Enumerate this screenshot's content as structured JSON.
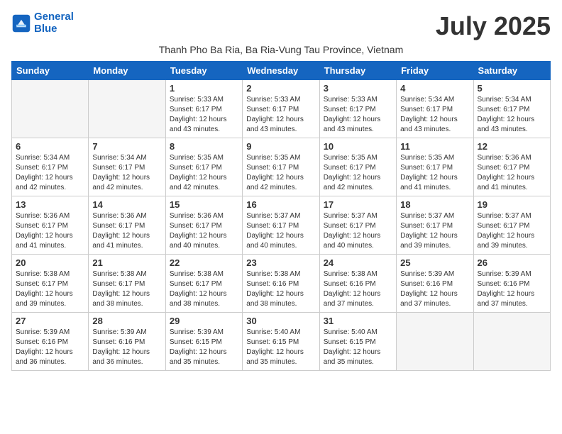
{
  "header": {
    "logo_line1": "General",
    "logo_line2": "Blue",
    "month_title": "July 2025",
    "subtitle": "Thanh Pho Ba Ria, Ba Ria-Vung Tau Province, Vietnam"
  },
  "weekdays": [
    "Sunday",
    "Monday",
    "Tuesday",
    "Wednesday",
    "Thursday",
    "Friday",
    "Saturday"
  ],
  "weeks": [
    [
      {
        "day": "",
        "info": ""
      },
      {
        "day": "",
        "info": ""
      },
      {
        "day": "1",
        "info": "Sunrise: 5:33 AM\nSunset: 6:17 PM\nDaylight: 12 hours and 43 minutes."
      },
      {
        "day": "2",
        "info": "Sunrise: 5:33 AM\nSunset: 6:17 PM\nDaylight: 12 hours and 43 minutes."
      },
      {
        "day": "3",
        "info": "Sunrise: 5:33 AM\nSunset: 6:17 PM\nDaylight: 12 hours and 43 minutes."
      },
      {
        "day": "4",
        "info": "Sunrise: 5:34 AM\nSunset: 6:17 PM\nDaylight: 12 hours and 43 minutes."
      },
      {
        "day": "5",
        "info": "Sunrise: 5:34 AM\nSunset: 6:17 PM\nDaylight: 12 hours and 43 minutes."
      }
    ],
    [
      {
        "day": "6",
        "info": "Sunrise: 5:34 AM\nSunset: 6:17 PM\nDaylight: 12 hours and 42 minutes."
      },
      {
        "day": "7",
        "info": "Sunrise: 5:34 AM\nSunset: 6:17 PM\nDaylight: 12 hours and 42 minutes."
      },
      {
        "day": "8",
        "info": "Sunrise: 5:35 AM\nSunset: 6:17 PM\nDaylight: 12 hours and 42 minutes."
      },
      {
        "day": "9",
        "info": "Sunrise: 5:35 AM\nSunset: 6:17 PM\nDaylight: 12 hours and 42 minutes."
      },
      {
        "day": "10",
        "info": "Sunrise: 5:35 AM\nSunset: 6:17 PM\nDaylight: 12 hours and 42 minutes."
      },
      {
        "day": "11",
        "info": "Sunrise: 5:35 AM\nSunset: 6:17 PM\nDaylight: 12 hours and 41 minutes."
      },
      {
        "day": "12",
        "info": "Sunrise: 5:36 AM\nSunset: 6:17 PM\nDaylight: 12 hours and 41 minutes."
      }
    ],
    [
      {
        "day": "13",
        "info": "Sunrise: 5:36 AM\nSunset: 6:17 PM\nDaylight: 12 hours and 41 minutes."
      },
      {
        "day": "14",
        "info": "Sunrise: 5:36 AM\nSunset: 6:17 PM\nDaylight: 12 hours and 41 minutes."
      },
      {
        "day": "15",
        "info": "Sunrise: 5:36 AM\nSunset: 6:17 PM\nDaylight: 12 hours and 40 minutes."
      },
      {
        "day": "16",
        "info": "Sunrise: 5:37 AM\nSunset: 6:17 PM\nDaylight: 12 hours and 40 minutes."
      },
      {
        "day": "17",
        "info": "Sunrise: 5:37 AM\nSunset: 6:17 PM\nDaylight: 12 hours and 40 minutes."
      },
      {
        "day": "18",
        "info": "Sunrise: 5:37 AM\nSunset: 6:17 PM\nDaylight: 12 hours and 39 minutes."
      },
      {
        "day": "19",
        "info": "Sunrise: 5:37 AM\nSunset: 6:17 PM\nDaylight: 12 hours and 39 minutes."
      }
    ],
    [
      {
        "day": "20",
        "info": "Sunrise: 5:38 AM\nSunset: 6:17 PM\nDaylight: 12 hours and 39 minutes."
      },
      {
        "day": "21",
        "info": "Sunrise: 5:38 AM\nSunset: 6:17 PM\nDaylight: 12 hours and 38 minutes."
      },
      {
        "day": "22",
        "info": "Sunrise: 5:38 AM\nSunset: 6:17 PM\nDaylight: 12 hours and 38 minutes."
      },
      {
        "day": "23",
        "info": "Sunrise: 5:38 AM\nSunset: 6:16 PM\nDaylight: 12 hours and 38 minutes."
      },
      {
        "day": "24",
        "info": "Sunrise: 5:38 AM\nSunset: 6:16 PM\nDaylight: 12 hours and 37 minutes."
      },
      {
        "day": "25",
        "info": "Sunrise: 5:39 AM\nSunset: 6:16 PM\nDaylight: 12 hours and 37 minutes."
      },
      {
        "day": "26",
        "info": "Sunrise: 5:39 AM\nSunset: 6:16 PM\nDaylight: 12 hours and 37 minutes."
      }
    ],
    [
      {
        "day": "27",
        "info": "Sunrise: 5:39 AM\nSunset: 6:16 PM\nDaylight: 12 hours and 36 minutes."
      },
      {
        "day": "28",
        "info": "Sunrise: 5:39 AM\nSunset: 6:16 PM\nDaylight: 12 hours and 36 minutes."
      },
      {
        "day": "29",
        "info": "Sunrise: 5:39 AM\nSunset: 6:15 PM\nDaylight: 12 hours and 35 minutes."
      },
      {
        "day": "30",
        "info": "Sunrise: 5:40 AM\nSunset: 6:15 PM\nDaylight: 12 hours and 35 minutes."
      },
      {
        "day": "31",
        "info": "Sunrise: 5:40 AM\nSunset: 6:15 PM\nDaylight: 12 hours and 35 minutes."
      },
      {
        "day": "",
        "info": ""
      },
      {
        "day": "",
        "info": ""
      }
    ]
  ]
}
